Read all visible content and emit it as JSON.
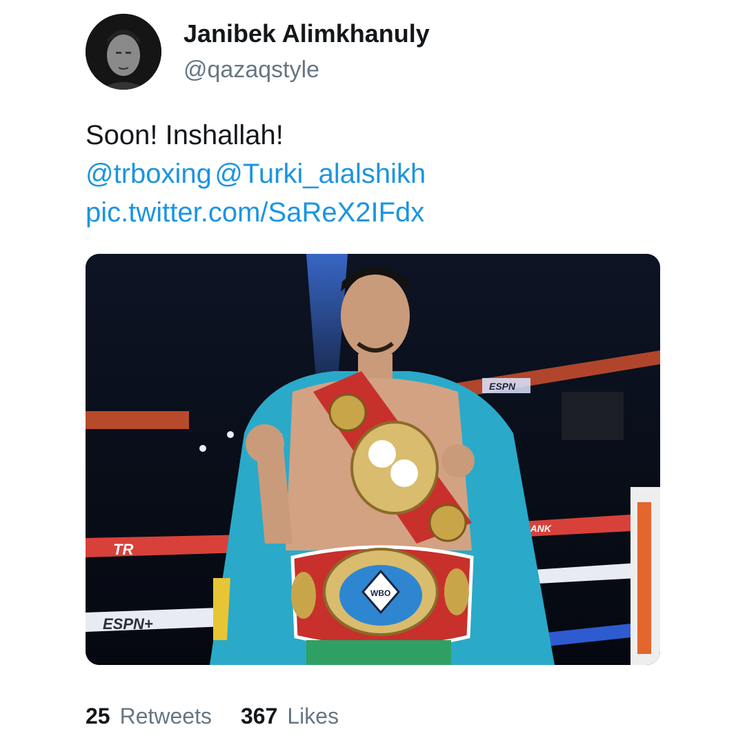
{
  "author": {
    "display_name": "Janibek Alimkhanuly",
    "handle": "@qazaqstyle",
    "avatar_icon": "profile-photo"
  },
  "tweet": {
    "text": "Soon! Inshallah!",
    "mentions": [
      "@trboxing",
      "@Turki_alalshikh"
    ],
    "media_link": "pic.twitter.com/SaReX2IFdx"
  },
  "media": {
    "description_icon": "boxer-with-championship-belts-photo",
    "ring_rope_labels": [
      "TR",
      "ESPN+",
      "TOPRANK",
      "ESPN"
    ],
    "belt_label": "WBO"
  },
  "stats": {
    "retweets_count": "25",
    "retweets_label": "Retweets",
    "likes_count": "367",
    "likes_label": "Likes"
  },
  "colors": {
    "link": "#1b95e0",
    "secondary_text": "#657786",
    "primary_text": "#14171a",
    "flag_blue": "#2aa9c9",
    "belt_red": "#c8302c",
    "belt_gold": "#c9a54a"
  }
}
